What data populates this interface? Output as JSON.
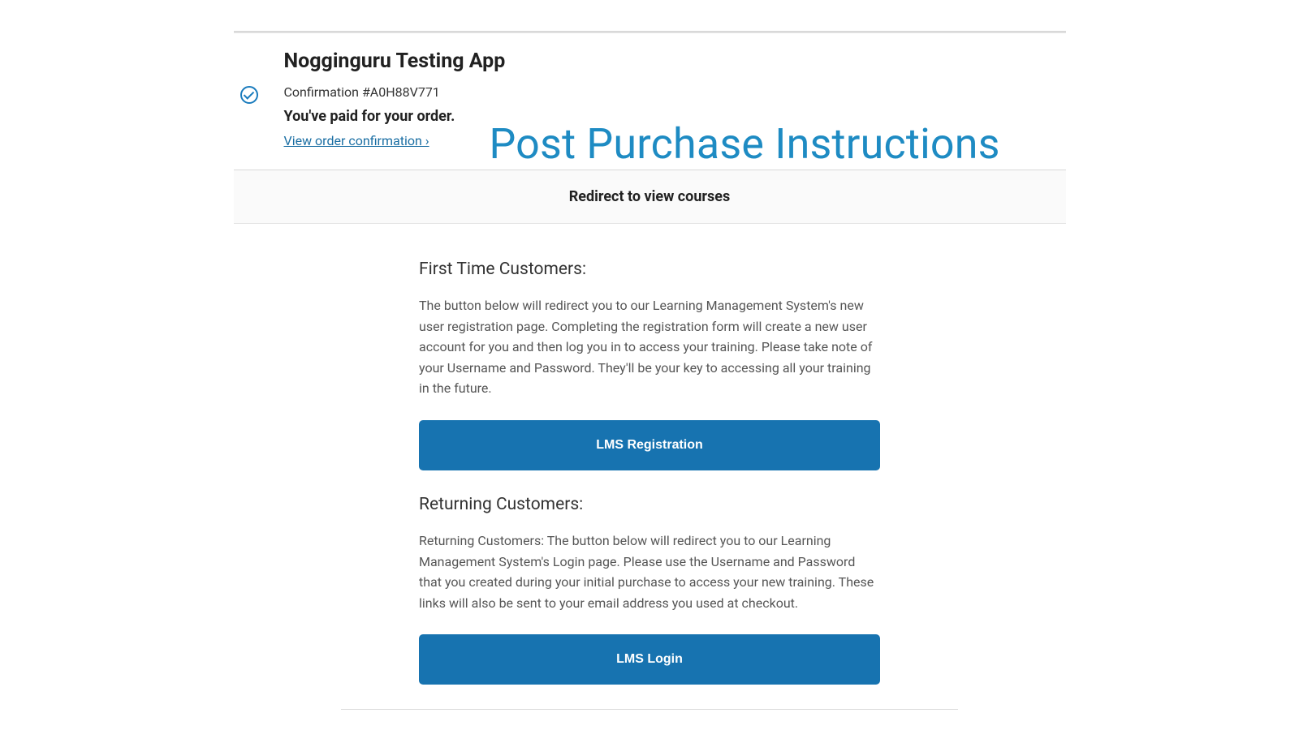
{
  "header": {
    "app_title": "Nogginguru Testing App",
    "confirmation": "Confirmation #A0H88V771",
    "paid_message": "You've paid for your order.",
    "view_order_link": "View order confirmation ›"
  },
  "overlay_title": "Post Purchase Instructions",
  "redirect_bar": "Redirect to view courses",
  "sections": {
    "first_time": {
      "heading": "First Time Customers:",
      "body": "The button below will redirect you to our Learning Management System's new user registration page. Completing the registration form will create a new user account for you and then log you in to access your training. Please take note of your Username and Password. They'll be your key to accessing all your training in the future.",
      "button_label": "LMS Registration"
    },
    "returning": {
      "heading": "Returning Customers:",
      "body": "Returning Customers: The button below will redirect you to our Learning Management System's Login page. Please use the Username and Password that you created during your initial purchase to access your new training. These links will also be sent to your email address you used at checkout.",
      "button_label": "LMS Login"
    }
  }
}
